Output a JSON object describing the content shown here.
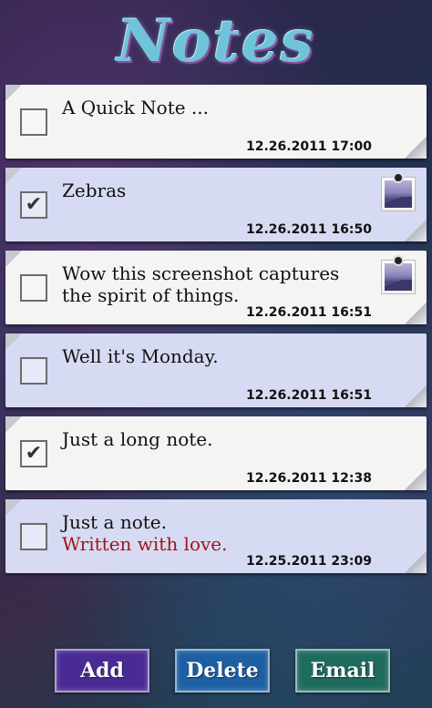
{
  "app": {
    "title": "Notes"
  },
  "notes": [
    {
      "text": "A Quick Note ...",
      "subtext": "",
      "timestamp": "12.26.2011 17:00",
      "checked": false,
      "has_image": false,
      "color": "white"
    },
    {
      "text": "Zebras",
      "subtext": "",
      "timestamp": "12.26.2011 16:50",
      "checked": true,
      "has_image": true,
      "color": "blue"
    },
    {
      "text": "Wow this screenshot captures the spirit of things.",
      "subtext": "",
      "timestamp": "12.26.2011 16:51",
      "checked": false,
      "has_image": true,
      "color": "white"
    },
    {
      "text": "Well it's Monday.",
      "subtext": "",
      "timestamp": "12.26.2011 16:51",
      "checked": false,
      "has_image": false,
      "color": "blue"
    },
    {
      "text": "Just a long note.",
      "subtext": "",
      "timestamp": "12.26.2011 12:38",
      "checked": true,
      "has_image": false,
      "color": "white"
    },
    {
      "text": "Just a note.",
      "subtext": "Written with love.",
      "timestamp": "12.25.2011 23:09",
      "checked": false,
      "has_image": false,
      "color": "blue"
    }
  ],
  "toolbar": {
    "add_label": "Add",
    "delete_label": "Delete",
    "email_label": "Email"
  },
  "icons": {
    "checkmark": "✔",
    "attachment": "pinned-photo-icon"
  },
  "colors": {
    "note_white": "#f4f4f2",
    "note_blue": "#d6dbf3",
    "subtext_red": "#a31515",
    "add_button": "#4a2b93",
    "delete_button": "#1d5fa3",
    "email_button": "#1f6b5e"
  }
}
